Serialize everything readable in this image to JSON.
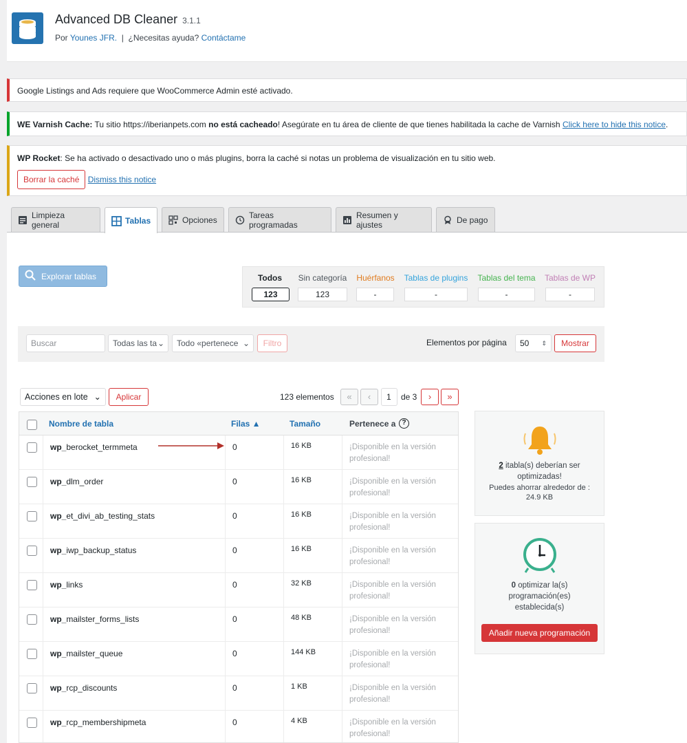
{
  "plugin": {
    "name": "Advanced DB Cleaner",
    "version": "3.1.1",
    "by_prefix": "Por",
    "author": "Younes JFR.",
    "separator": "|",
    "help_text": "¿Necesitas ayuda?",
    "contact_link": "Contáctame"
  },
  "notices": {
    "google": "Google Listings and Ads requiere que WooCommerce Admin esté activado.",
    "varnish_label": "WE Varnish Cache:",
    "varnish_text1": "Tu sitio https://iberianpets.com",
    "varnish_bold": "no está cacheado",
    "varnish_text2": "! Asegúrate en tu área de cliente de que tienes habilitada la cache de Varnish",
    "varnish_link": "Click here to hide this notice",
    "varnish_end": ".",
    "rocket_label": "WP Rocket",
    "rocket_text": ": Se ha activado o desactivado uno o más plugins, borra la caché si notas un problema de visualización en tu sitio web.",
    "rocket_button": "Borrar la caché",
    "rocket_dismiss": "Dismiss this notice"
  },
  "tabs": [
    {
      "label": "Limpieza general",
      "icon": "document-icon"
    },
    {
      "label": "Tablas",
      "icon": "table-icon"
    },
    {
      "label": "Opciones",
      "icon": "qr-icon"
    },
    {
      "label": "Tareas programadas",
      "icon": "clock-icon"
    },
    {
      "label": "Resumen y ajustes",
      "icon": "chart-icon"
    },
    {
      "label": "De pago",
      "icon": "award-icon"
    }
  ],
  "explore_button": "Explorar tablas",
  "categories": [
    {
      "label": "Todos",
      "value": "123",
      "color": "#1d2327"
    },
    {
      "label": "Sin categoría",
      "value": "123",
      "color": "#50575e"
    },
    {
      "label": "Huérfanos",
      "value": "-",
      "color": "#e07b1e"
    },
    {
      "label": "Tablas de plugins",
      "value": "-",
      "color": "#33a3dc"
    },
    {
      "label": "Tablas del tema",
      "value": "-",
      "color": "#46b450"
    },
    {
      "label": "Tablas de WP",
      "value": "-",
      "color": "#c17fb5"
    }
  ],
  "filters": {
    "search_placeholder": "Buscar",
    "type_select": "Todas las ta",
    "owner_select": "Todo «pertenece",
    "filter_button": "Filtro",
    "per_page_label": "Elementos por página",
    "per_page_value": "50",
    "show_button": "Mostrar"
  },
  "bulk": {
    "actions": "Acciones en lote",
    "apply": "Aplicar",
    "count": "123 elementos",
    "first": "«",
    "prev": "‹",
    "page": "1",
    "of": "de 3",
    "next": "›",
    "last": "»"
  },
  "table": {
    "headers": [
      "Nombre de tabla",
      "Filas ▲",
      "Tamaño",
      "Pertenece a"
    ],
    "help_glyph": "?",
    "prefix": "wp_",
    "rows": [
      {
        "name": "berocket_termmeta",
        "rows": "0",
        "size": "16 KB",
        "owner": "¡Disponible en la versión profesional!"
      },
      {
        "name": "dlm_order",
        "rows": "0",
        "size": "16 KB",
        "owner": "¡Disponible en la versión profesional!"
      },
      {
        "name": "et_divi_ab_testing_stats",
        "rows": "0",
        "size": "16 KB",
        "owner": "¡Disponible en la versión profesional!"
      },
      {
        "name": "iwp_backup_status",
        "rows": "0",
        "size": "16 KB",
        "owner": "¡Disponible en la versión profesional!"
      },
      {
        "name": "links",
        "rows": "0",
        "size": "32 KB",
        "owner": "¡Disponible en la versión profesional!"
      },
      {
        "name": "mailster_forms_lists",
        "rows": "0",
        "size": "48 KB",
        "owner": "¡Disponible en la versión profesional!"
      },
      {
        "name": "mailster_queue",
        "rows": "0",
        "size": "144 KB",
        "owner": "¡Disponible en la versión profesional!"
      },
      {
        "name": "rcp_discounts",
        "rows": "0",
        "size": "1 KB",
        "owner": "¡Disponible en la versión profesional!"
      },
      {
        "name": "rcp_membershipmeta",
        "rows": "0",
        "size": "4 KB",
        "owner": "¡Disponible en la versión profesional!"
      }
    ]
  },
  "optimize_box": {
    "count": "2",
    "text1": "itabla(s) deberían ser optimizadas!",
    "text2": "Puedes ahorrar alrededor de :",
    "text3": "24.9 KB"
  },
  "schedule_box": {
    "count": "0",
    "text": "optimizar la(s) programación(es) establecida(s)",
    "button": "Añadir nueva programación"
  }
}
